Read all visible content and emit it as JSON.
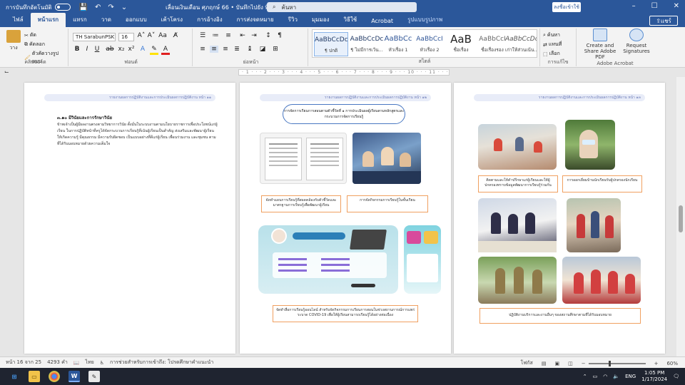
{
  "titlebar": {
    "autosave_label": "การบันทึกอัตโนมัติ",
    "document_title": "เลื่อนเงินเดือน ศุภฤกษ์ 66 • บันทึกไปยัง พีซีนี้",
    "search_placeholder": "ค้นหา",
    "signin_label": "ลงชื่อเข้าใช้"
  },
  "tabs": [
    "ไฟล์",
    "หน้าแรก",
    "แทรก",
    "วาด",
    "ออกแบบ",
    "เค้าโครง",
    "การอ้างอิง",
    "การส่งจดหมาย",
    "รีวิว",
    "มุมมอง",
    "วิธีใช้",
    "Acrobat",
    "รูปแบบรูปภาพ"
  ],
  "share_label": "แชร์",
  "ribbon": {
    "clipboard": {
      "paste": "วาง",
      "cut": "ตัด",
      "copy": "คัดลอก",
      "format_painter": "ตัวคัดวางรูปแบบ",
      "label": "คลิปบอร์ด"
    },
    "font": {
      "name": "TH SarabunPSK",
      "size": "16",
      "label": "ฟอนต์"
    },
    "paragraph": {
      "label": "ย่อหน้า"
    },
    "styles": {
      "label": "สไตล์",
      "items": [
        {
          "sample": "AaBbCcDc",
          "name": "¶ ปกติ"
        },
        {
          "sample": "AaBbCcDc",
          "name": "¶ ไม่มีการเว้น..."
        },
        {
          "sample": "AaBbCc",
          "name": "หัวเรื่อง 1"
        },
        {
          "sample": "AaBbCcI",
          "name": "หัวเรื่อง 2"
        },
        {
          "sample": "AaB",
          "name": "ชื่อเรื่อง"
        },
        {
          "sample": "AaBbCcI",
          "name": "ชื่อเรื่องรอง"
        },
        {
          "sample": "AaBbCcDc",
          "name": "เก่าให้ส่วนเน้น..."
        }
      ]
    },
    "editing": {
      "find": "ค้นหา",
      "replace": "แทนที่",
      "select": "เลือก",
      "label": "การแก้ไข"
    },
    "acrobat": {
      "create_share": "Create and Share Adobe PDF",
      "request": "Request Signatures",
      "label": "Adobe Acrobat"
    }
  },
  "ruler_text": "· 1 · · · 2 · · · 3 · · · 4 · · · 5 · · · 6 · · · 7 · · · 8 · · · 9 · · · 10 · · · 11 · · · 12 · · · 13 · · · 14 · · · 15 · · · 16",
  "pages": [
    {
      "header": "รายงานผลการปฏิบัติงานและการประเมินผลการปฏิบัติงาน หน้า ๑๑",
      "heading": "๓.๑๐ มีวินัยและการรักษาวินัย",
      "body": "ข้าพเจ้าเป็นผู้มีผลงานตรงตามวิทยาการวินัย ตั้งมั่นในระบบงานตามนโยบายราชการเพื่อประโยชน์แก่ผู้เรียน ในการปฏิบัติหน้าที่ครูได้จัดกระบวนการเรียนรู้ที่เน้นผู้เรียนเป็นสำคัญ ส่งเสริมและพัฒนาผู้เรียนให้เกิดความรู้ มีคุณธรรม มีความรับผิดชอบ เป็นแบบอย่างที่ดีแก่ผู้เรียน เพื่อนร่วมงาน และชุมชน ตามที่ได้รับมอบหมายด้วยความเต็มใจ"
    },
    {
      "header": "รายงานผลการปฏิบัติงานและการประเมินผลการปฏิบัติงาน หน้า ๑๒",
      "oval": "การจัดการเรียนการสอนตามตัวชี้วัดที่ ๑ การประเมินผลผู้เรียนตามหลักสูตรและกระบวนการจัดการเรียนรู้",
      "caption1": "จัดทำแผนการเรียนรู้ที่สอดคล้องกับตัวชี้วัดและมาตรฐานการเรียนรู้เพื่อพัฒนาผู้เรียน",
      "caption2": "การจัดกิจกรรมการเรียนรู้ในชั้นเรียน",
      "caption3": "จัดทำสื่อการเรียนรู้ออนไลน์ สำหรับจัดกิจกรรมการเรียนการสอนในช่วงสถานการณ์การแพร่ระบาด COVID-19 เพื่อให้ผู้เรียนสามารถเรียนรู้ได้อย่างต่อเนื่อง"
    },
    {
      "header": "รายงานผลการปฏิบัติงานและการประเมินผลการปฏิบัติงาน หน้า ๑๓",
      "caption1": "ติดตามและให้คำปรึกษาแก่ผู้เรียนและให้ผู้ปกครองทราบข้อมูลพัฒนาการเรียนรู้ร่วมกัน",
      "caption2": "การออกเยี่ยมบ้านนักเรียนรับผู้ปกครองนักเรียน",
      "caption3": "ปฏิบัติงานบริการและงานอื่นๆ ของสถานศึกษาตามที่ได้รับมอบหมาย"
    }
  ],
  "statusbar": {
    "page": "หน้า 16 จาก 25",
    "words": "4293 คำ",
    "language": "ไทย",
    "accessibility": "การช่วยสำหรับการเข้าถึง: โปรดศึกษาคำแนะนำ",
    "focus": "โฟกัส",
    "zoom": "60%"
  },
  "taskbar": {
    "lang": "ENG",
    "time": "1:05 PM",
    "date": "1/17/2024"
  },
  "colors": {
    "word_blue": "#2b579a",
    "caption_border": "#f0a060"
  }
}
